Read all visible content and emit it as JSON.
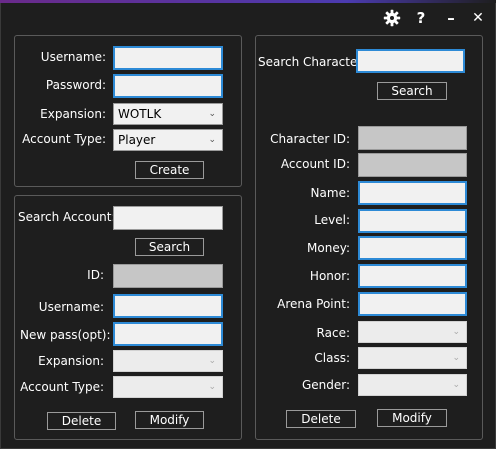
{
  "window": {
    "settings_icon": "gear-icon",
    "help_label": "?",
    "minimize_label": "–",
    "close_label": "✕"
  },
  "create_panel": {
    "username_label": "Username:",
    "username_value": "",
    "password_label": "Password:",
    "password_value": "",
    "expansion_label": "Expansion:",
    "expansion_value": "WOTLK",
    "account_type_label": "Account Type:",
    "account_type_value": "Player",
    "create_button": "Create"
  },
  "account_panel": {
    "search_label": "Search Account:",
    "search_value": "",
    "search_button": "Search",
    "id_label": "ID:",
    "id_value": "",
    "username_label": "Username:",
    "username_value": "",
    "newpass_label": "New pass(opt):",
    "newpass_value": "",
    "expansion_label": "Expansion:",
    "expansion_value": "",
    "account_type_label": "Account Type:",
    "account_type_value": "",
    "delete_button": "Delete",
    "modify_button": "Modify"
  },
  "character_panel": {
    "search_label": "Search Character:",
    "search_value": "",
    "search_button": "Search",
    "character_id_label": "Character ID:",
    "account_id_label": "Account ID:",
    "name_label": "Name:",
    "level_label": "Level:",
    "money_label": "Money:",
    "honor_label": "Honor:",
    "arena_label": "Arena Point:",
    "race_label": "Race:",
    "class_label": "Class:",
    "gender_label": "Gender:",
    "delete_button": "Delete",
    "modify_button": "Modify"
  }
}
